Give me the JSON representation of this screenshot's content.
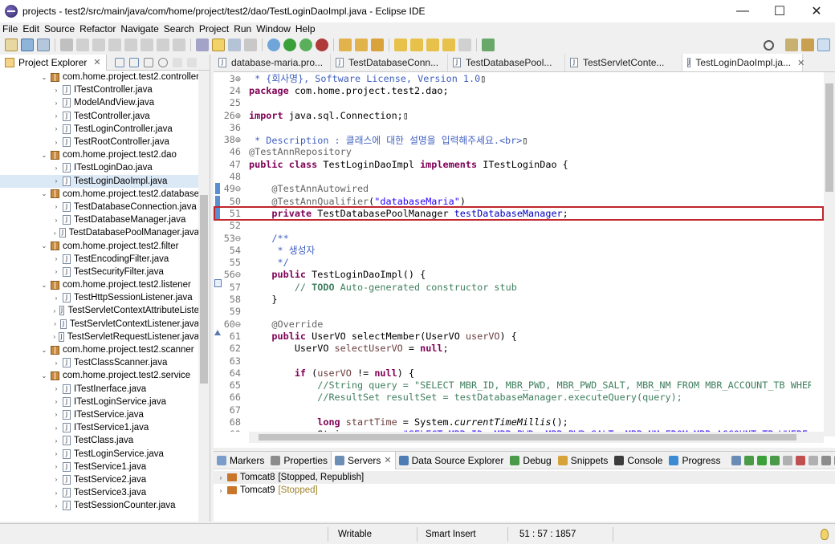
{
  "window": {
    "title": "projects - test2/src/main/java/com/home/project/test2/dao/TestLoginDaoImpl.java - Eclipse IDE",
    "minimize": "—",
    "maximize": "☐",
    "close": "✕"
  },
  "menu": [
    "File",
    "Edit",
    "Source",
    "Refactor",
    "Navigate",
    "Search",
    "Project",
    "Run",
    "Window",
    "Help"
  ],
  "project_explorer": {
    "title": "Project Explorer",
    "items": [
      {
        "label": "com.home.project.test2.controller",
        "type": "package"
      },
      {
        "label": "ITestController.java",
        "type": "file"
      },
      {
        "label": "ModelAndView.java",
        "type": "file"
      },
      {
        "label": "TestController.java",
        "type": "file"
      },
      {
        "label": "TestLoginController.java",
        "type": "file"
      },
      {
        "label": "TestRootController.java",
        "type": "file"
      },
      {
        "label": "com.home.project.test2.dao",
        "type": "package"
      },
      {
        "label": "ITestLoginDao.java",
        "type": "file"
      },
      {
        "label": "TestLoginDaoImpl.java",
        "type": "file",
        "selected": true
      },
      {
        "label": "com.home.project.test2.database",
        "type": "package"
      },
      {
        "label": "TestDatabaseConnection.java",
        "type": "file"
      },
      {
        "label": "TestDatabaseManager.java",
        "type": "file"
      },
      {
        "label": "TestDatabasePoolManager.java",
        "type": "file"
      },
      {
        "label": "com.home.project.test2.filter",
        "type": "package"
      },
      {
        "label": "TestEncodingFilter.java",
        "type": "file"
      },
      {
        "label": "TestSecurityFilter.java",
        "type": "file"
      },
      {
        "label": "com.home.project.test2.listener",
        "type": "package"
      },
      {
        "label": "TestHttpSessionListener.java",
        "type": "file"
      },
      {
        "label": "TestServletContextAttributeListe",
        "type": "file"
      },
      {
        "label": "TestServletContextListener.java",
        "type": "file"
      },
      {
        "label": "TestServletRequestListener.java",
        "type": "file"
      },
      {
        "label": "com.home.project.test2.scanner",
        "type": "package"
      },
      {
        "label": "TestClassScanner.java",
        "type": "file"
      },
      {
        "label": "com.home.project.test2.service",
        "type": "package"
      },
      {
        "label": "ITestInerface.java",
        "type": "file"
      },
      {
        "label": "ITestLoginService.java",
        "type": "file"
      },
      {
        "label": "ITestService.java",
        "type": "file"
      },
      {
        "label": "ITestService1.java",
        "type": "file"
      },
      {
        "label": "TestClass.java",
        "type": "file"
      },
      {
        "label": "TestLoginService.java",
        "type": "file"
      },
      {
        "label": "TestService1.java",
        "type": "file"
      },
      {
        "label": "TestService2.java",
        "type": "file"
      },
      {
        "label": "TestService3.java",
        "type": "file"
      },
      {
        "label": "TestSessionCounter.java",
        "type": "file"
      }
    ]
  },
  "editor_tabs": [
    {
      "label": "database-maria.pro..."
    },
    {
      "label": "TestDatabaseConn..."
    },
    {
      "label": "TestDatabasePool..."
    },
    {
      "label": "TestServletConte..."
    },
    {
      "label": "TestLoginDaoImpl.ja...",
      "active": true
    }
  ],
  "code_lines": [
    {
      "ln": "3⊕",
      "html": "<span class=\"jd\"> * {회사명}, Software License, Version 1.0</span>▯"
    },
    {
      "ln": "24",
      "html": "<span class=\"kw\">package</span> com.home.project.test2.dao;"
    },
    {
      "ln": "25",
      "html": ""
    },
    {
      "ln": "26⊕",
      "html": "<span class=\"kw\">import</span> java.sql.Connection;▯"
    },
    {
      "ln": "36",
      "html": ""
    },
    {
      "ln": "38⊕",
      "html": "<span class=\"jd\"> * Description : 클래스에 대한 설명을 입력해주세요.&lt;br&gt;</span>▯"
    },
    {
      "ln": "46",
      "html": "<span class=\"an\">@TestAnnRepository</span>"
    },
    {
      "ln": "47",
      "html": "<span class=\"kw\">public class</span> TestLoginDaoImpl <span class=\"kw\">implements</span> ITestLoginDao {"
    },
    {
      "ln": "48",
      "html": ""
    },
    {
      "ln": "49⊖",
      "html": "    <span class=\"an\">@TestAnnAutowired</span>"
    },
    {
      "ln": "50",
      "html": "    <span class=\"an\">@TestAnnQualifier</span>(<span class=\"str\">\"databaseMaria\"</span>)"
    },
    {
      "ln": "51",
      "html": "    <span class=\"kw\">private</span> TestDatabasePoolManager <span class=\"fld\">testDatabaseManager</span>;"
    },
    {
      "ln": "52",
      "html": ""
    },
    {
      "ln": "53⊖",
      "html": "    <span class=\"jd\">/**</span>"
    },
    {
      "ln": "54",
      "html": "<span class=\"jd\">     * 생성자</span>"
    },
    {
      "ln": "55",
      "html": "<span class=\"jd\">     */</span>"
    },
    {
      "ln": "56⊖",
      "html": "    <span class=\"kw\">public</span> TestLoginDaoImpl() {"
    },
    {
      "ln": "57",
      "html": "        <span class=\"cm\">// <b>TODO</b> Auto-generated constructor stub</span>"
    },
    {
      "ln": "58",
      "html": "    }"
    },
    {
      "ln": "59",
      "html": ""
    },
    {
      "ln": "60⊖",
      "html": "    <span class=\"an\">@Override</span>"
    },
    {
      "ln": "61",
      "html": "    <span class=\"kw\">public</span> UserVO selectMember(UserVO <span class=\"fld\" style=\"color:#6a3e3e\">userVO</span>) {"
    },
    {
      "ln": "62",
      "html": "        UserVO <span style=\"color:#6a3e3e\">selectUserVO</span> = <span class=\"kw\">null</span>;"
    },
    {
      "ln": "63",
      "html": ""
    },
    {
      "ln": "64",
      "html": "        <span class=\"kw\">if</span> (<span style=\"color:#6a3e3e\">userVO</span> != <span class=\"kw\">null</span>) {"
    },
    {
      "ln": "65",
      "html": "            <span class=\"cm\">//String query = \"SELECT MBR_ID, MBR_PWD, MBR_PWD_SALT, MBR_NM FROM MBR_ACCOUNT_TB WHERE MBR_</span>"
    },
    {
      "ln": "66",
      "html": "            <span class=\"cm\">//ResultSet resultSet = testDatabaseManager.executeQuery(query);</span>"
    },
    {
      "ln": "67",
      "html": ""
    },
    {
      "ln": "68",
      "html": "            <span class=\"kw\">long</span> <span style=\"color:#6a3e3e\">startTime</span> = System.<span class=\"it\">currentTimeMillis</span>();"
    },
    {
      "ln": "69",
      "html": "            String <span style=\"color:#6a3e3e\">query</span> = <span class=\"str\">\"SELECT MBR_ID, MBR_PWD, MBR_PWD_SALT, MBR_NM FROM MBR_ACCOUNT_TB WHERE MBR_ID</span>"
    }
  ],
  "bottom_tabs": [
    {
      "label": "Markers",
      "color": "#7a9cc9"
    },
    {
      "label": "Properties",
      "color": "#8c8c8c"
    },
    {
      "label": "Servers",
      "color": "#6b8fb5",
      "active": true
    },
    {
      "label": "Data Source Explorer",
      "color": "#4d7cb5"
    },
    {
      "label": "Debug",
      "color": "#4a9a4a"
    },
    {
      "label": "Snippets",
      "color": "#d6a23a"
    },
    {
      "label": "Console",
      "color": "#3c3c3c"
    },
    {
      "label": "Progress",
      "color": "#3b8bd4"
    }
  ],
  "servers": [
    {
      "name": "Tomcat8",
      "status": "[Stopped, Republish]",
      "selected": true
    },
    {
      "name": "Tomcat9",
      "status": "[Stopped]"
    }
  ],
  "status_bar": {
    "writable": "Writable",
    "insert_mode": "Smart Insert",
    "position": "51 : 57 : 1857"
  }
}
